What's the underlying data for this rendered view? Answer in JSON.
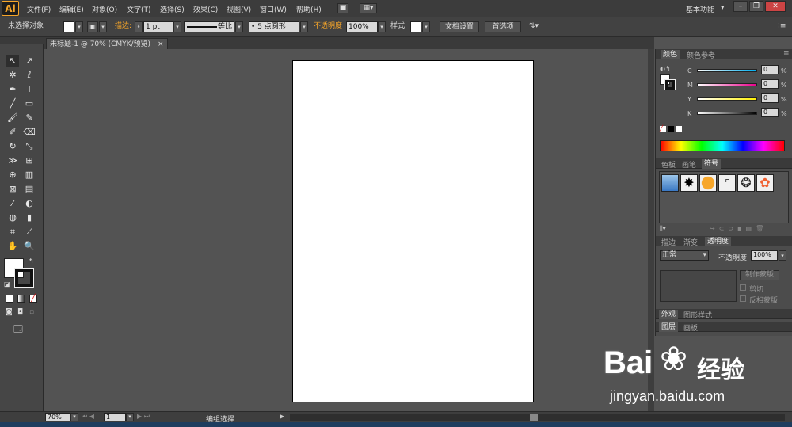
{
  "app": {
    "logo": "Ai"
  },
  "menu": [
    "文件(F)",
    "编辑(E)",
    "对象(O)",
    "文字(T)",
    "选择(S)",
    "效果(C)",
    "视图(V)",
    "窗口(W)",
    "帮助(H)"
  ],
  "workspace": "基本功能",
  "control": {
    "selection": "未选择对象",
    "stroke_label": "描边:",
    "stroke_weight": "1 pt",
    "stroke_profile": "等比",
    "brush": "5 点圆形",
    "opacity_label": "不透明度",
    "opacity": "100%",
    "style_label": "样式:",
    "doc_setup": "文档设置",
    "prefs": "首选项"
  },
  "doc_tab": {
    "title": "未标题-1 @ 70% (CMYK/预览)",
    "close": "×"
  },
  "status": {
    "zoom": "70%",
    "artboard": "1",
    "mode": "编组选择"
  },
  "panels": {
    "color": {
      "tabs": [
        "颜色",
        "颜色参考"
      ],
      "channels": [
        {
          "label": "C",
          "value": "0"
        },
        {
          "label": "M",
          "value": "0"
        },
        {
          "label": "Y",
          "value": "0"
        },
        {
          "label": "K",
          "value": "0"
        }
      ],
      "unit": "%"
    },
    "swatch": {
      "tabs": [
        "色板",
        "画笔",
        "符号"
      ]
    },
    "transparency": {
      "tabs": [
        "描边",
        "渐变",
        "透明度"
      ],
      "blend": "正常",
      "opacity_label": "不透明度:",
      "opacity": "100%",
      "make_mask": "制作蒙版",
      "clip": "剪切",
      "invert": "反相蒙版"
    },
    "appearance": {
      "tabs": [
        "外观",
        "图形样式"
      ]
    },
    "layers": {
      "tabs": [
        "图层",
        "画板"
      ]
    }
  },
  "watermark": {
    "brand": "Bai",
    "brand2": "经验",
    "url": "jingyan.baidu.com"
  },
  "colors": {
    "accent": "#f7a629",
    "cyan": "#00aeef",
    "magenta": "#ec008c",
    "yellow": "#fff200"
  }
}
